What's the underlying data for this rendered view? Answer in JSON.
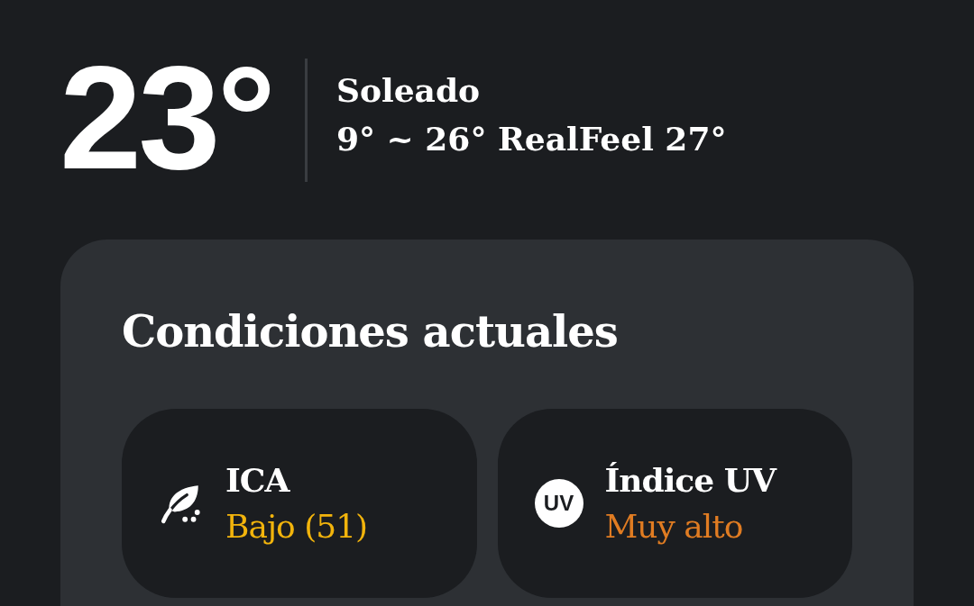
{
  "current": {
    "temperature": "23°",
    "condition": "Soleado",
    "range": "9° ~ 26° RealFeel 27°"
  },
  "conditions_card": {
    "title": "Condiciones actuales",
    "tiles": [
      {
        "kind": "air_quality",
        "label": "ICA",
        "value": "Bajo (51)",
        "color": "#f2b40c"
      },
      {
        "kind": "uv",
        "badge": "UV",
        "label": "Índice UV",
        "value": "Muy alto",
        "color": "#e07c22"
      }
    ]
  }
}
